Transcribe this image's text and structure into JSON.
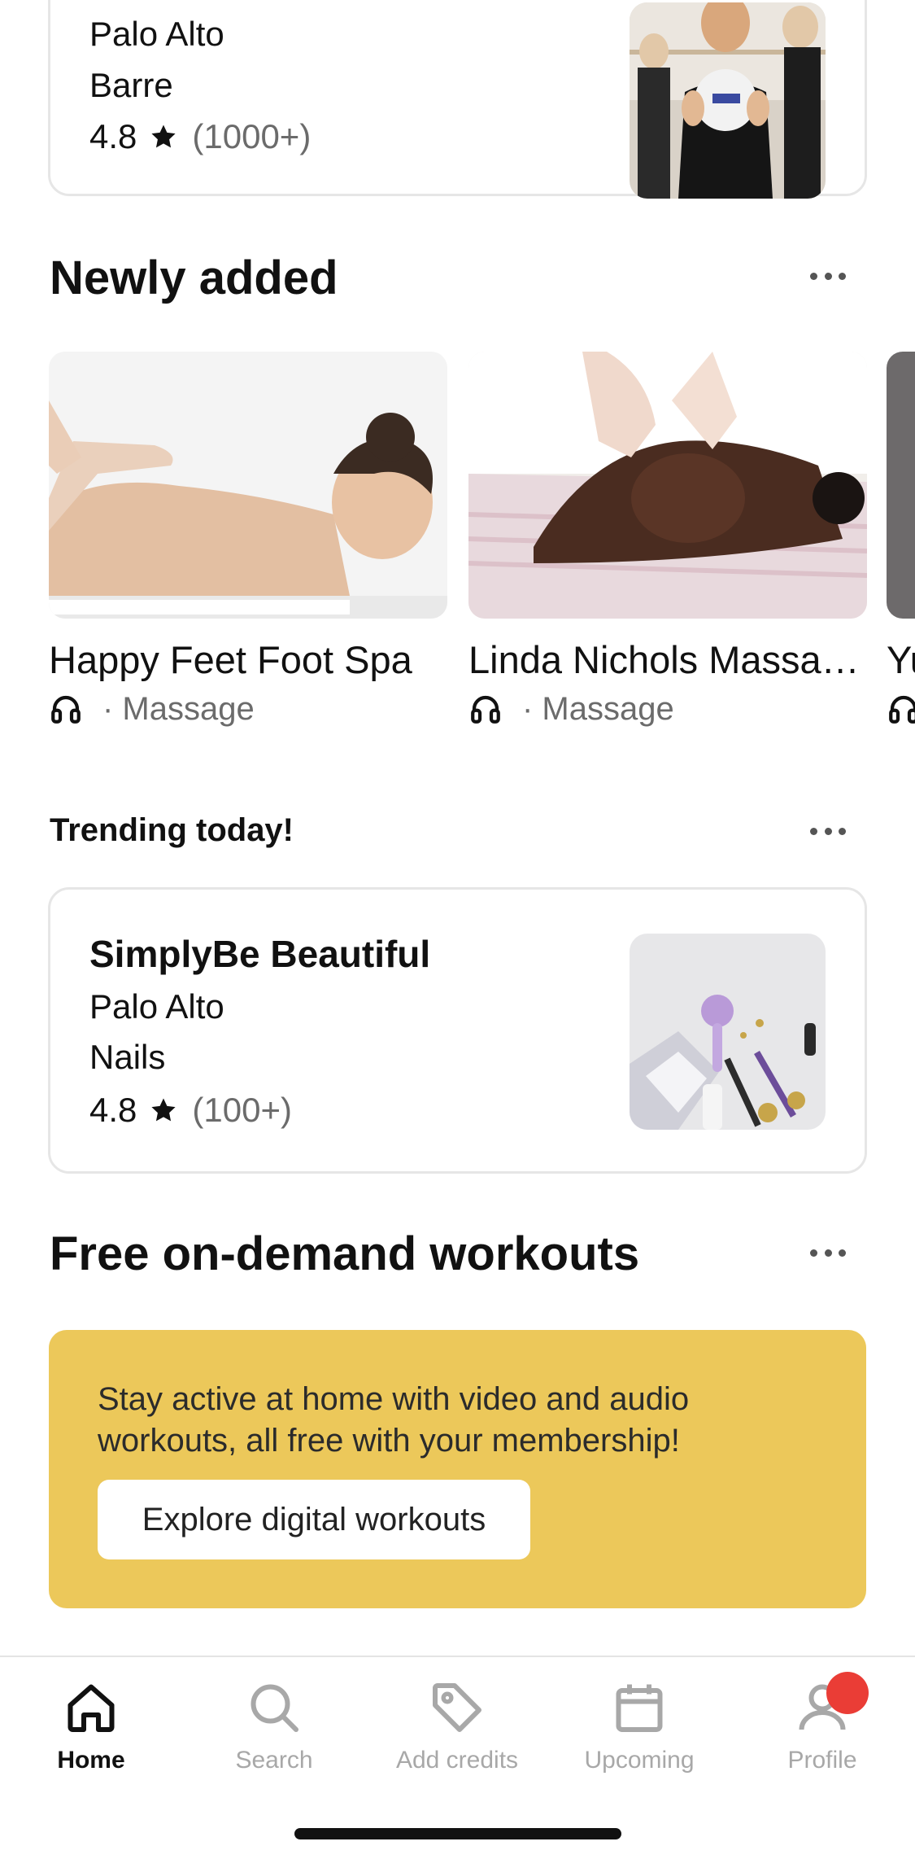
{
  "top_card": {
    "location": "Palo Alto",
    "category": "Barre",
    "rating": "4.8",
    "reviews": "(1000+)"
  },
  "newly_added": {
    "title": "Newly added",
    "items": [
      {
        "name": "Happy Feet Foot Spa",
        "category": "· Massage"
      },
      {
        "name": "Linda Nichols Massa…",
        "category": "· Massage"
      },
      {
        "name": "Yu",
        "category": ""
      }
    ]
  },
  "trending": {
    "title": "Trending today!",
    "card": {
      "name": "SimplyBe Beautiful",
      "location": "Palo Alto",
      "category": "Nails",
      "rating": "4.8",
      "reviews": "(100+)"
    }
  },
  "workouts": {
    "title": "Free on-demand workouts",
    "promo_text": "Stay active at home with video and audio workouts, all free with your membership!",
    "button_label": "Explore digital workouts"
  },
  "tabs": [
    {
      "label": "Home",
      "icon": "home-icon",
      "active": true
    },
    {
      "label": "Search",
      "icon": "search-icon",
      "active": false
    },
    {
      "label": "Add credits",
      "icon": "tag-icon",
      "active": false
    },
    {
      "label": "Upcoming",
      "icon": "calendar-icon",
      "active": false
    },
    {
      "label": "Profile",
      "icon": "profile-icon",
      "active": false
    }
  ],
  "colors": {
    "promo_bg": "#ecc85a",
    "badge": "#ea3d36",
    "muted_text": "#6b6b6b",
    "tab_inactive": "#a8a8a8"
  }
}
